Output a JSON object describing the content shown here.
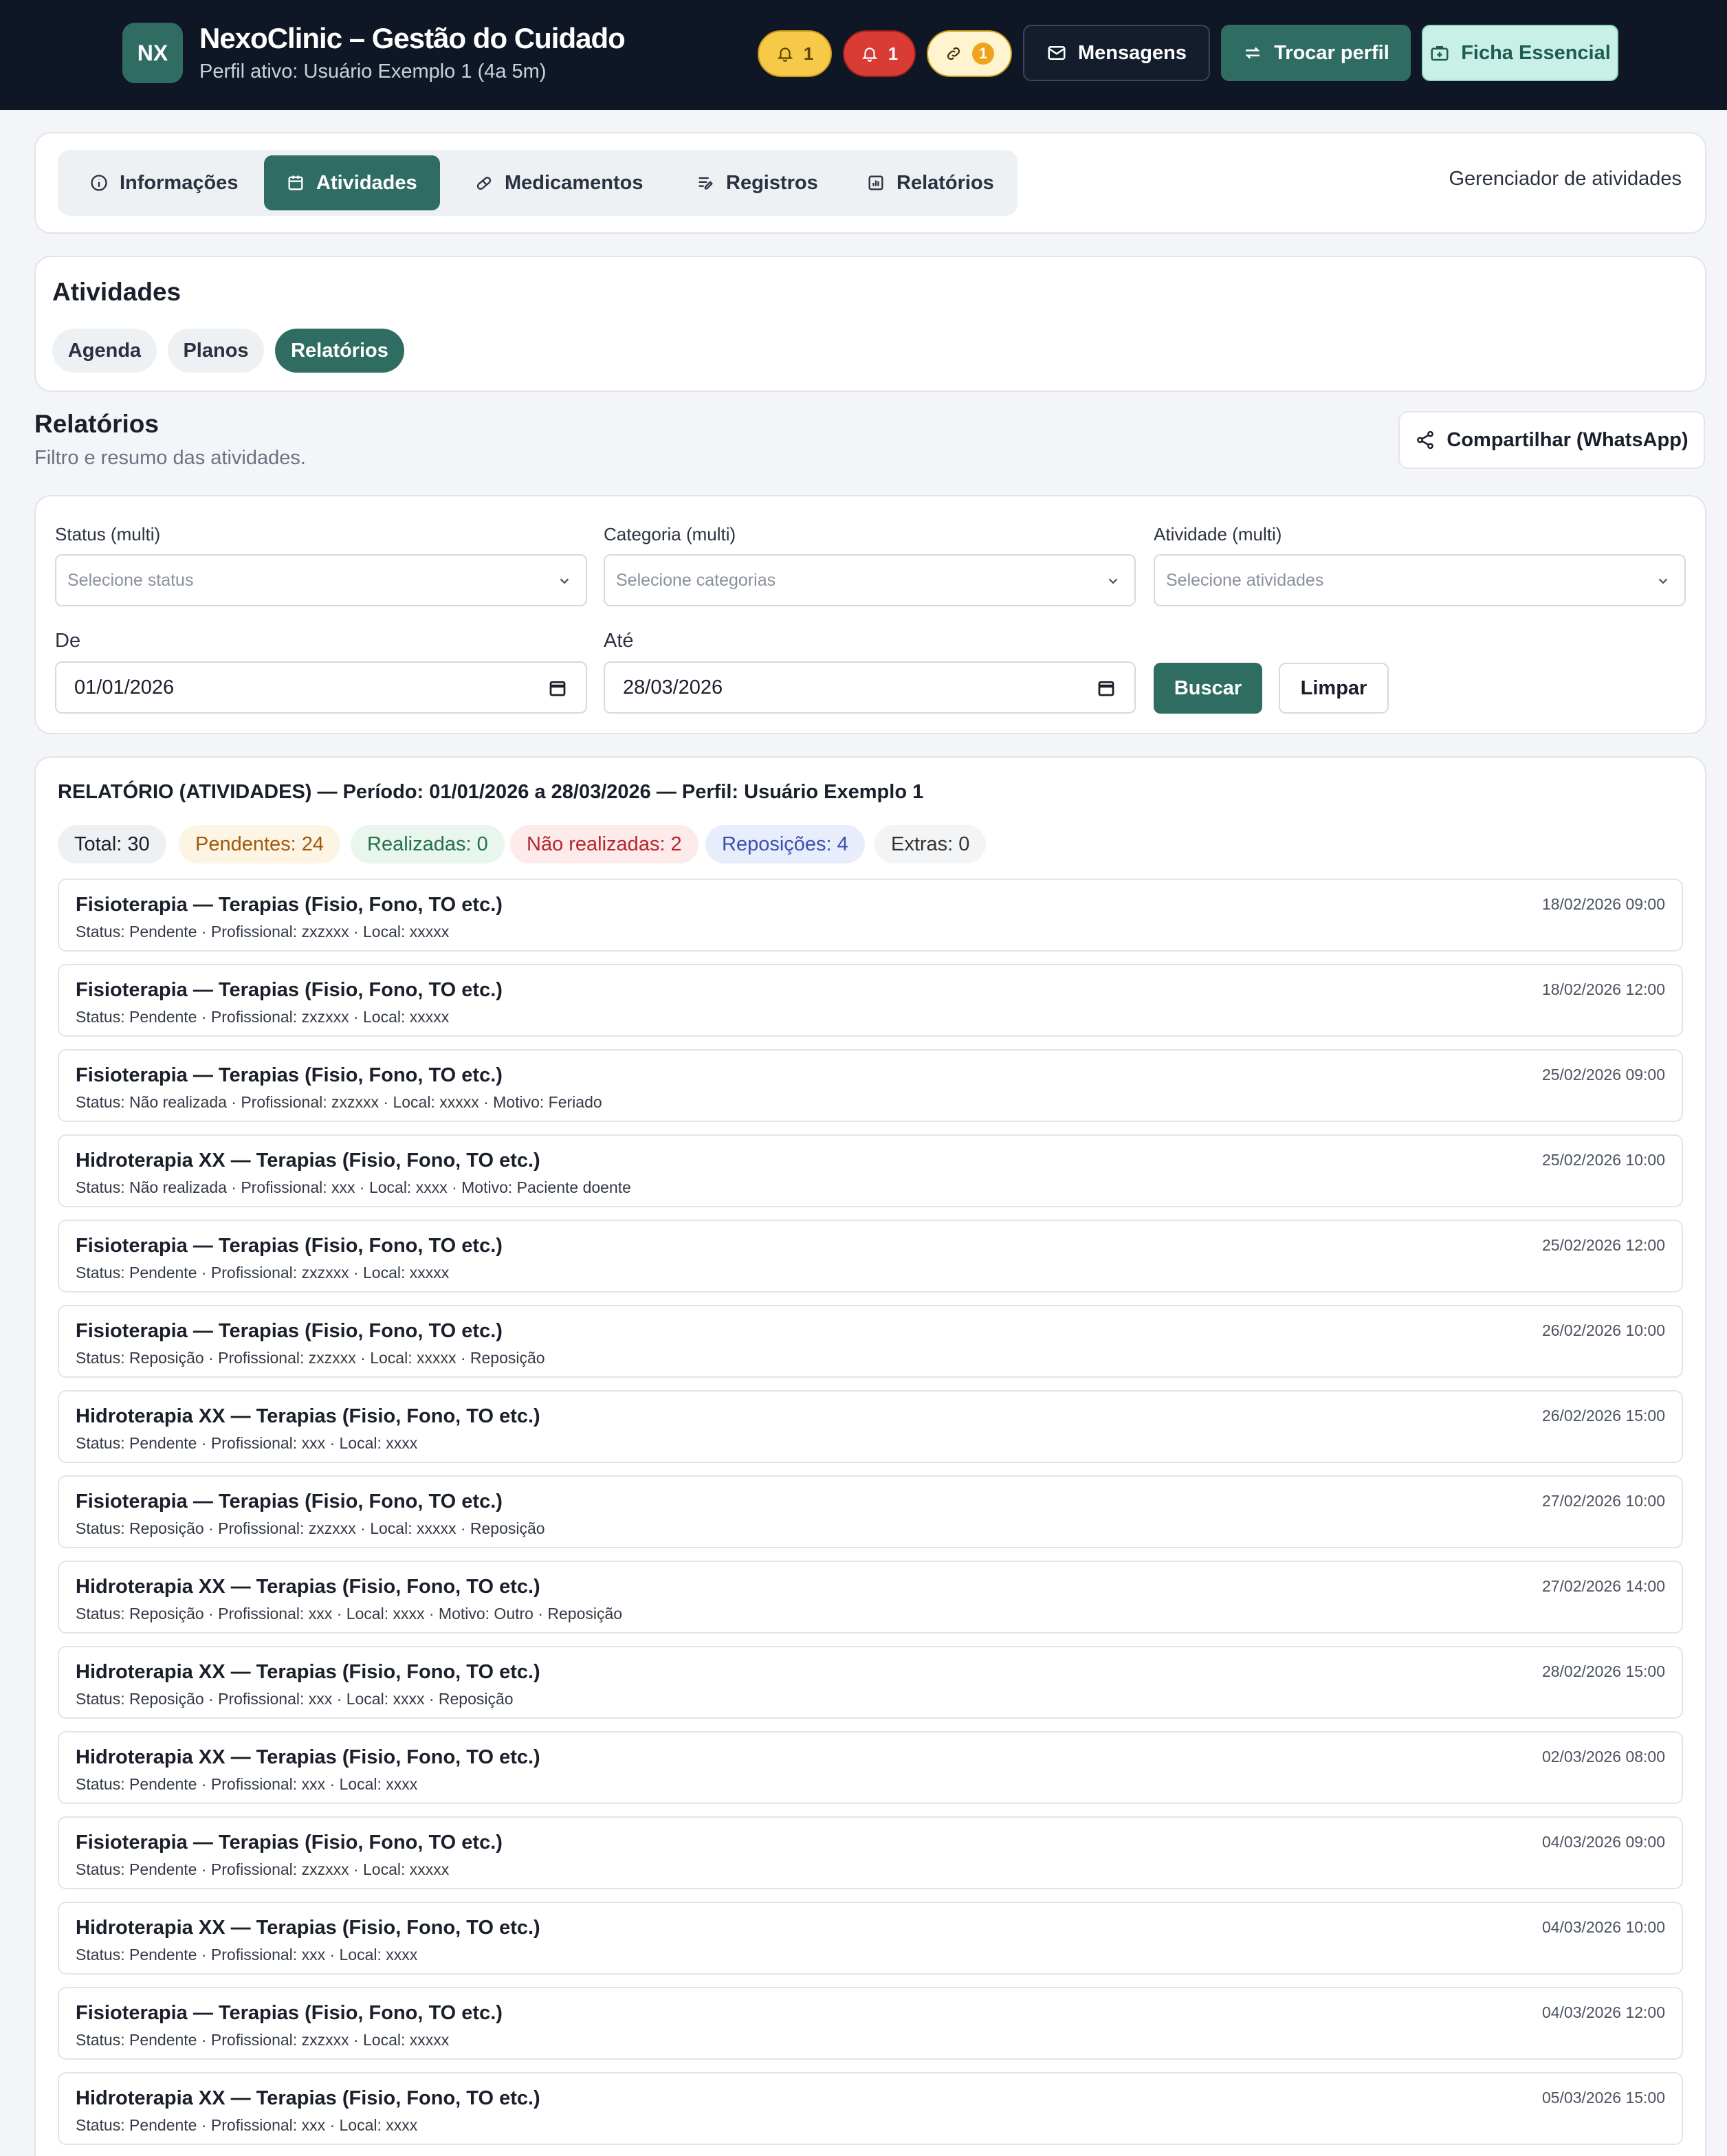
{
  "header": {
    "logo": "NX",
    "title": "NexoClinic – Gestão do Cuidado",
    "subtitle": "Perfil ativo: Usuário Exemplo 1 (4a 5m)",
    "badges": [
      {
        "icon": "bell-icon",
        "count": "1",
        "color": "#f7c948"
      },
      {
        "icon": "bell-icon",
        "count": "1",
        "color": "#d93b35"
      },
      {
        "icon": "link-icon",
        "count": "1",
        "color": "#fff4cf"
      }
    ],
    "messages_label": "Mensagens",
    "switch_label": "Trocar perfil",
    "ficha_label": "Ficha Essencial"
  },
  "tabs": {
    "items": [
      {
        "label": "Informações",
        "icon": "info-icon"
      },
      {
        "label": "Atividades",
        "icon": "calendar-icon",
        "active": true
      },
      {
        "label": "Medicamentos",
        "icon": "pill-icon"
      },
      {
        "label": "Registros",
        "icon": "notes-icon"
      },
      {
        "label": "Relatórios",
        "icon": "report-icon"
      }
    ],
    "manager_label": "Gerenciador de atividades"
  },
  "activities": {
    "title": "Atividades",
    "subtabs": [
      "Agenda",
      "Planos",
      "Relatórios"
    ],
    "active_subtab": "Relatórios"
  },
  "reports": {
    "title": "Relatórios",
    "subtitle": "Filtro e resumo das atividades.",
    "share_label": "Compartilhar (WhatsApp)"
  },
  "filters": {
    "status_label": "Status (multi)",
    "status_placeholder": "Selecione status",
    "category_label": "Categoria (multi)",
    "category_placeholder": "Selecione categorias",
    "activity_label": "Atividade (multi)",
    "activity_placeholder": "Selecione atividades",
    "from_label": "De",
    "from_value": "01/01/2026",
    "to_label": "Até",
    "to_value": "28/03/2026",
    "search_label": "Buscar",
    "clear_label": "Limpar"
  },
  "report": {
    "heading": "RELATÓRIO (ATIVIDADES) — Período: 01/01/2026 a 28/03/2026 — Perfil: Usuário Exemplo 1",
    "summary": {
      "total": "Total: 30",
      "pending": "Pendentes: 24",
      "done": "Realizadas: 0",
      "not_done": "Não realizadas: 2",
      "replacements": "Reposições: 4",
      "extras": "Extras: 0"
    },
    "colors": {
      "accent": "#2f6d62",
      "header_bg": "#0f1726"
    },
    "items": [
      {
        "title": "Fisioterapia — Terapias (Fisio, Fono, TO etc.)",
        "meta": "Status: Pendente · Profissional: zxzxxx · Local: xxxxx",
        "date": "18/02/2026 09:00"
      },
      {
        "title": "Fisioterapia — Terapias (Fisio, Fono, TO etc.)",
        "meta": "Status: Pendente · Profissional: zxzxxx · Local: xxxxx",
        "date": "18/02/2026 12:00"
      },
      {
        "title": "Fisioterapia — Terapias (Fisio, Fono, TO etc.)",
        "meta": "Status: Não realizada · Profissional: zxzxxx · Local: xxxxx · Motivo: Feriado",
        "date": "25/02/2026 09:00"
      },
      {
        "title": "Hidroterapia XX — Terapias (Fisio, Fono, TO etc.)",
        "meta": "Status: Não realizada · Profissional: xxx · Local: xxxx · Motivo: Paciente doente",
        "date": "25/02/2026 10:00"
      },
      {
        "title": "Fisioterapia — Terapias (Fisio, Fono, TO etc.)",
        "meta": "Status: Pendente · Profissional: zxzxxx · Local: xxxxx",
        "date": "25/02/2026 12:00"
      },
      {
        "title": "Fisioterapia — Terapias (Fisio, Fono, TO etc.)",
        "meta": "Status: Reposição · Profissional: zxzxxx · Local: xxxxx · Reposição",
        "date": "26/02/2026 10:00"
      },
      {
        "title": "Hidroterapia XX — Terapias (Fisio, Fono, TO etc.)",
        "meta": "Status: Pendente · Profissional: xxx · Local: xxxx",
        "date": "26/02/2026 15:00"
      },
      {
        "title": "Fisioterapia — Terapias (Fisio, Fono, TO etc.)",
        "meta": "Status: Reposição · Profissional: zxzxxx · Local: xxxxx · Reposição",
        "date": "27/02/2026 10:00"
      },
      {
        "title": "Hidroterapia XX — Terapias (Fisio, Fono, TO etc.)",
        "meta": "Status: Reposição · Profissional: xxx · Local: xxxx · Motivo: Outro · Reposição",
        "date": "27/02/2026 14:00"
      },
      {
        "title": "Hidroterapia XX — Terapias (Fisio, Fono, TO etc.)",
        "meta": "Status: Reposição · Profissional: xxx · Local: xxxx · Reposição",
        "date": "28/02/2026 15:00"
      },
      {
        "title": "Hidroterapia XX — Terapias (Fisio, Fono, TO etc.)",
        "meta": "Status: Pendente · Profissional: xxx · Local: xxxx",
        "date": "02/03/2026 08:00"
      },
      {
        "title": "Fisioterapia — Terapias (Fisio, Fono, TO etc.)",
        "meta": "Status: Pendente · Profissional: zxzxxx · Local: xxxxx",
        "date": "04/03/2026 09:00"
      },
      {
        "title": "Hidroterapia XX — Terapias (Fisio, Fono, TO etc.)",
        "meta": "Status: Pendente · Profissional: xxx · Local: xxxx",
        "date": "04/03/2026 10:00"
      },
      {
        "title": "Fisioterapia — Terapias (Fisio, Fono, TO etc.)",
        "meta": "Status: Pendente · Profissional: zxzxxx · Local: xxxxx",
        "date": "04/03/2026 12:00"
      },
      {
        "title": "Hidroterapia XX — Terapias (Fisio, Fono, TO etc.)",
        "meta": "Status: Pendente · Profissional: xxx · Local: xxxx",
        "date": "05/03/2026 15:00"
      }
    ]
  }
}
